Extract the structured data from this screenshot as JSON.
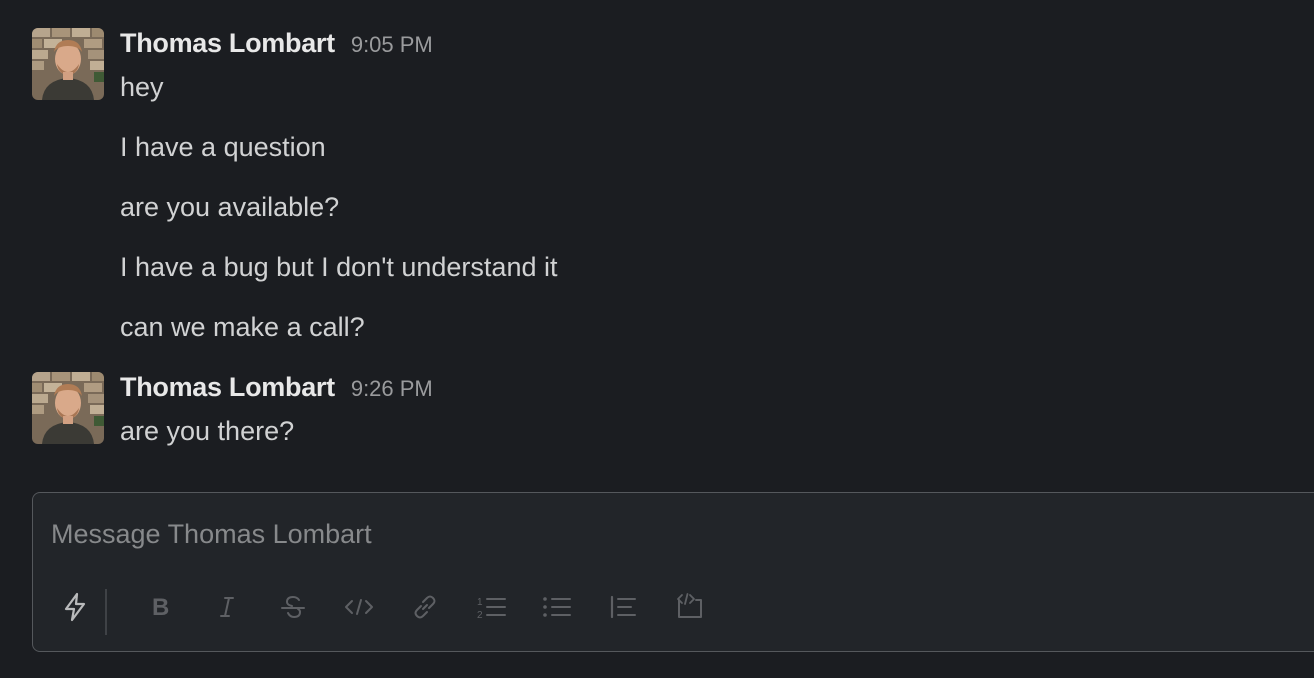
{
  "conversation": {
    "groups": [
      {
        "author": "Thomas Lombart",
        "time": "9:05 PM",
        "lines": [
          "hey",
          "I have a question",
          "are you available?",
          "I have a bug but I don't understand it",
          "can we make a call?"
        ]
      },
      {
        "author": "Thomas Lombart",
        "time": "9:26 PM",
        "lines": [
          "are you there?"
        ]
      }
    ]
  },
  "composer": {
    "placeholder": "Message Thomas Lombart",
    "toolbar": [
      {
        "icon": "lightning-icon",
        "name": "shortcuts-button"
      },
      {
        "icon": "bold-icon",
        "name": "bold-button"
      },
      {
        "icon": "italic-icon",
        "name": "italic-button"
      },
      {
        "icon": "strikethrough-icon",
        "name": "strikethrough-button"
      },
      {
        "icon": "code-icon",
        "name": "code-button"
      },
      {
        "icon": "link-icon",
        "name": "link-button"
      },
      {
        "icon": "ordered-list-icon",
        "name": "ordered-list-button"
      },
      {
        "icon": "bulleted-list-icon",
        "name": "bulleted-list-button"
      },
      {
        "icon": "blockquote-icon",
        "name": "blockquote-button"
      },
      {
        "icon": "code-block-icon",
        "name": "code-block-button"
      }
    ]
  },
  "colors": {
    "background": "#1b1d21",
    "composer_background": "#222529",
    "composer_border": "#55585c",
    "author_text": "#e8e8e8",
    "message_text": "#d1d2d3",
    "timestamp_text": "#9a9b9d",
    "placeholder_text": "#87898b",
    "toolbar_icon_disabled": "#5e6064",
    "toolbar_icon_active": "#b9babb"
  }
}
